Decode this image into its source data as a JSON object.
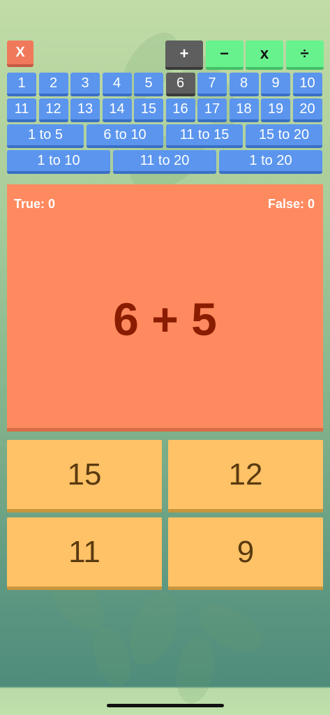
{
  "toolbar": {
    "close_label": "X",
    "operators": [
      {
        "label": "+",
        "selected": true
      },
      {
        "label": "−",
        "selected": false
      },
      {
        "label": "x",
        "selected": false
      },
      {
        "label": "÷",
        "selected": false
      }
    ]
  },
  "numbers": {
    "row1": [
      "1",
      "2",
      "3",
      "4",
      "5",
      "6",
      "7",
      "8",
      "9",
      "10"
    ],
    "row2": [
      "11",
      "12",
      "13",
      "14",
      "15",
      "16",
      "17",
      "18",
      "19",
      "20"
    ],
    "selected": "6"
  },
  "ranges": {
    "row1": [
      "1 to 5",
      "6 to 10",
      "11 to 15",
      "15 to 20"
    ],
    "row2": [
      "1 to 10",
      "11 to 20",
      "1 to 20"
    ]
  },
  "score": {
    "true_label": "True: 0",
    "false_label": "False: 0"
  },
  "question": "6 + 5",
  "answers": [
    "15",
    "12",
    "11",
    "9"
  ],
  "colors": {
    "number_button": "#5b95ee",
    "selected_button": "#5e5e5e",
    "operator_button": "#67f28d",
    "close_button": "#f0795b",
    "question_card": "#ff8a5f",
    "question_text": "#8a1c00",
    "answer_button": "#ffc266"
  }
}
